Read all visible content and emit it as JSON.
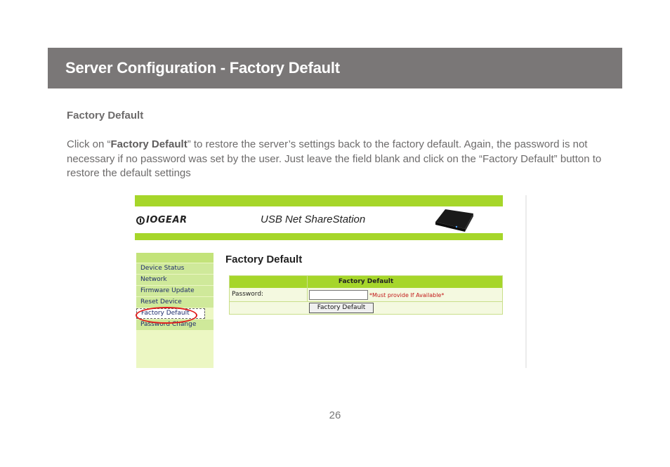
{
  "banner": {
    "title": "Server Configuration - Factory Default"
  },
  "section": {
    "heading": "Factory Default",
    "text_before": "Click on “",
    "text_bold": "Factory Default",
    "text_after": "” to restore the server’s settings back to the factory default. Again, the password is not necessary if no password was set by the user. Just leave the field blank and click on the “Factory Default” button to restore the default settings"
  },
  "screenshot": {
    "logo_text": "IOGEAR",
    "product_title": "USB Net ShareStation",
    "menu": [
      {
        "label": "Device Status"
      },
      {
        "label": "Network"
      },
      {
        "label": "Firmware Update"
      },
      {
        "label": "Reset Device"
      },
      {
        "label": "Factory Default",
        "active": true
      },
      {
        "label": "Password Change"
      }
    ],
    "page_title": "Factory Default",
    "panel": {
      "header": "Factory Default",
      "password_label": "Password:",
      "password_value": "",
      "note": "*Must provide If Available*",
      "button_label": "Factory Default"
    },
    "colors": {
      "accent_green": "#a6d62a",
      "highlight_circle": "#e01b1b"
    }
  },
  "page_number": "26"
}
